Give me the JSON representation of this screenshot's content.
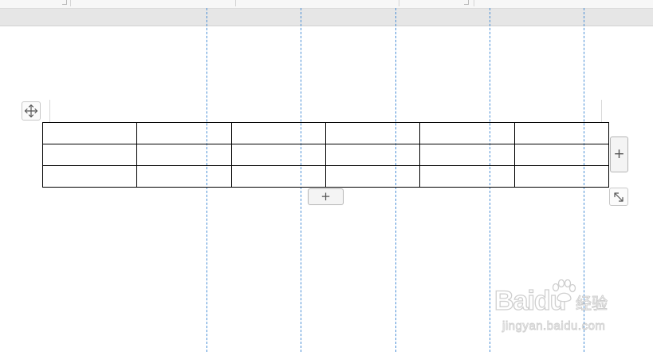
{
  "document": {
    "table": {
      "rows": [
        [
          "",
          "",
          "",
          "",
          "",
          ""
        ],
        [
          "",
          "",
          "",
          "",
          "",
          ""
        ],
        [
          "",
          "",
          "",
          "",
          "",
          ""
        ]
      ]
    },
    "add_column_label": "+",
    "add_row_label": "+"
  },
  "watermark": {
    "logo_text": "Baidu",
    "logo_suffix": "经验",
    "url": "jingyan.baidu.com"
  },
  "colors": {
    "guide_line": "#4a8fd6",
    "page_gap": "#e6e6e6",
    "table_border": "#000000"
  },
  "icons": {
    "table_handle": "move-arrows-icon",
    "resize_handle": "resize-diagonal-icon"
  }
}
